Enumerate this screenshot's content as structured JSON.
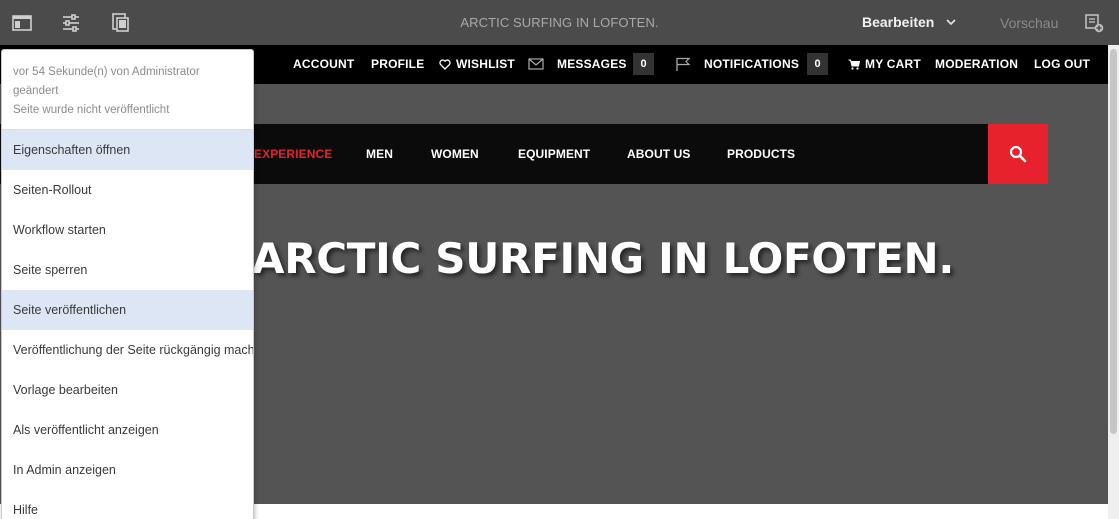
{
  "topbar": {
    "page_title": "ARCTIC SURFING IN LOFOTEN.",
    "mode_label": "Bearbeiten",
    "preview_label": "Vorschau",
    "icons": [
      "side-panel-icon",
      "page-properties-icon",
      "emulator-icon",
      "annotate-icon"
    ]
  },
  "utility_nav": {
    "account": "ACCOUNT",
    "profile": "PROFILE",
    "wishlist": "WISHLIST",
    "messages": "MESSAGES",
    "messages_count": "0",
    "notifications": "NOTIFICATIONS",
    "notifications_count": "0",
    "cart": "MY CART",
    "moderation": "MODERATION",
    "logout": "LOG OUT"
  },
  "main_nav": {
    "experience": "EXPERIENCE",
    "men": "MEN",
    "women": "WOMEN",
    "equipment": "EQUIPMENT",
    "about": "ABOUT US",
    "products": "PRODUCTS"
  },
  "hero": {
    "title": "ARCTIC SURFING IN LOFOTEN."
  },
  "page_menu": {
    "info_modified": "vor 54 Sekunde(n) von Administrator geändert",
    "info_status": "Seite wurde nicht veröffentlicht",
    "items": [
      "Eigenschaften öffnen",
      "Seiten-Rollout",
      "Workflow starten",
      "Seite sperren",
      "Seite veröffentlichen",
      "Veröffentlichung der Seite rückgängig machen",
      "Vorlage bearbeiten",
      "Als veröffentlicht anzeigen",
      "In Admin anzeigen",
      "Hilfe"
    ]
  },
  "colors": {
    "accent_red": "#e8222c",
    "editor_bar": "#4b4b4b",
    "menu_highlight": "#dde6f4"
  }
}
